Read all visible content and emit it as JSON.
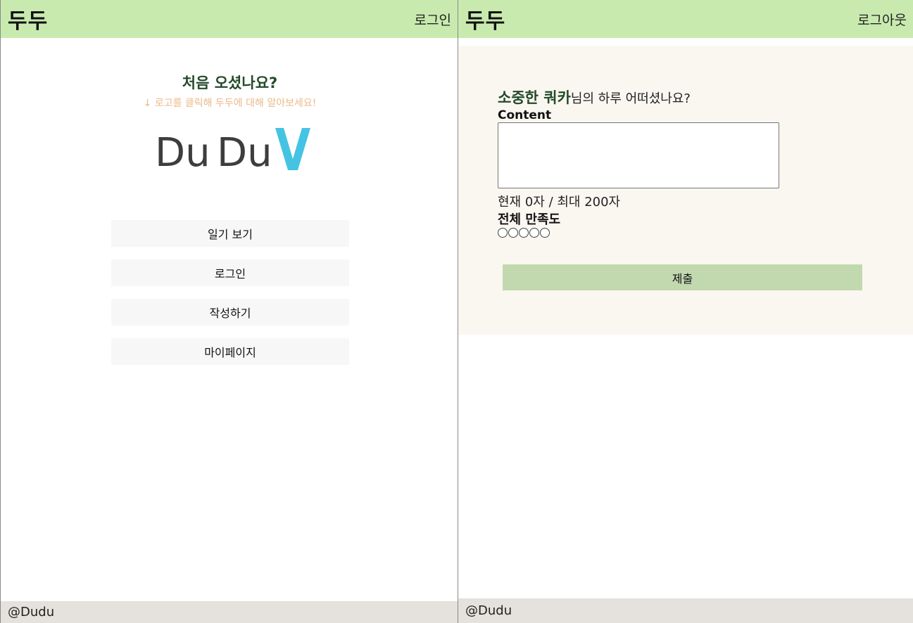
{
  "left": {
    "header": {
      "brand": "두두",
      "login_link": "로그인"
    },
    "welcome": {
      "title": "처음 오셨나요?",
      "subtitle": "↓ 로고를 클릭해 두두에 대해 알아보세요!"
    },
    "logo": {
      "text_part1": "Du",
      "text_part2": "Du",
      "mark": "V"
    },
    "menu": [
      {
        "label": "일기 보기"
      },
      {
        "label": "로그인"
      },
      {
        "label": "작성하기"
      },
      {
        "label": "마이페이지"
      }
    ],
    "footer": "@Dudu"
  },
  "right": {
    "header": {
      "brand": "두두",
      "logout_link": "로그아웃"
    },
    "greeting": {
      "user_name": "소중한 쿼카",
      "suffix": "님의 하루 어떠셨나요?"
    },
    "content_label": "Content",
    "content_value": "",
    "char_count": "현재 0자 / 최대 200자",
    "rating_label": "전체 만족도",
    "rating": {
      "selected": 0,
      "max": 5
    },
    "submit_label": "제출",
    "footer": "@Dudu"
  },
  "colors": {
    "header_bg": "#c8eaaf",
    "accent_green": "#244a2a",
    "hint_orange": "#ecb98a",
    "button_bg": "#f7f7f7",
    "submit_bg": "#c2d9b0",
    "panel_bg": "#faf7f1",
    "footer_bg": "#e5e1dc",
    "logo_gray": "#3d3d3d",
    "logo_cyan": "#45c3e3"
  }
}
